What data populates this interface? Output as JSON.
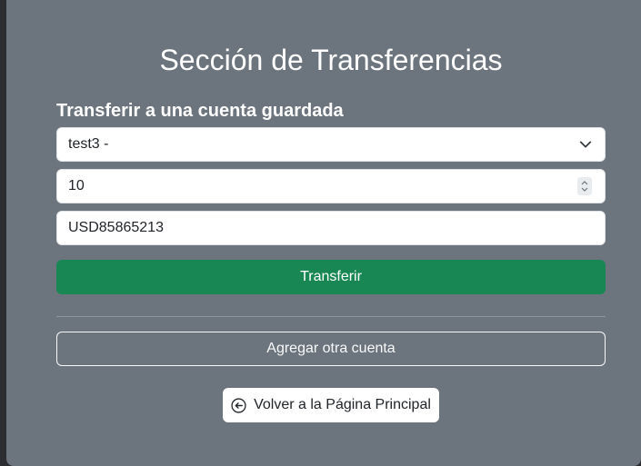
{
  "page": {
    "title": "Sección de Transferencias",
    "subtitle": "Transferir a una cuenta guardada"
  },
  "form": {
    "selected_account": "test3 -",
    "amount": "10",
    "destination_account": "USD85865213"
  },
  "buttons": {
    "transfer_label": "Transferir",
    "add_account_label": "Agregar otra cuenta",
    "back_label": "Volver a la Página Principal"
  },
  "icons": {
    "select_arrow": "chevron-down-icon",
    "number_spinner": "spinner-icon",
    "back": "arrow-left-circle-icon"
  },
  "colors": {
    "card_background": "#6c757d",
    "transfer_button": "#198754",
    "page_background": "#2b2d30"
  }
}
